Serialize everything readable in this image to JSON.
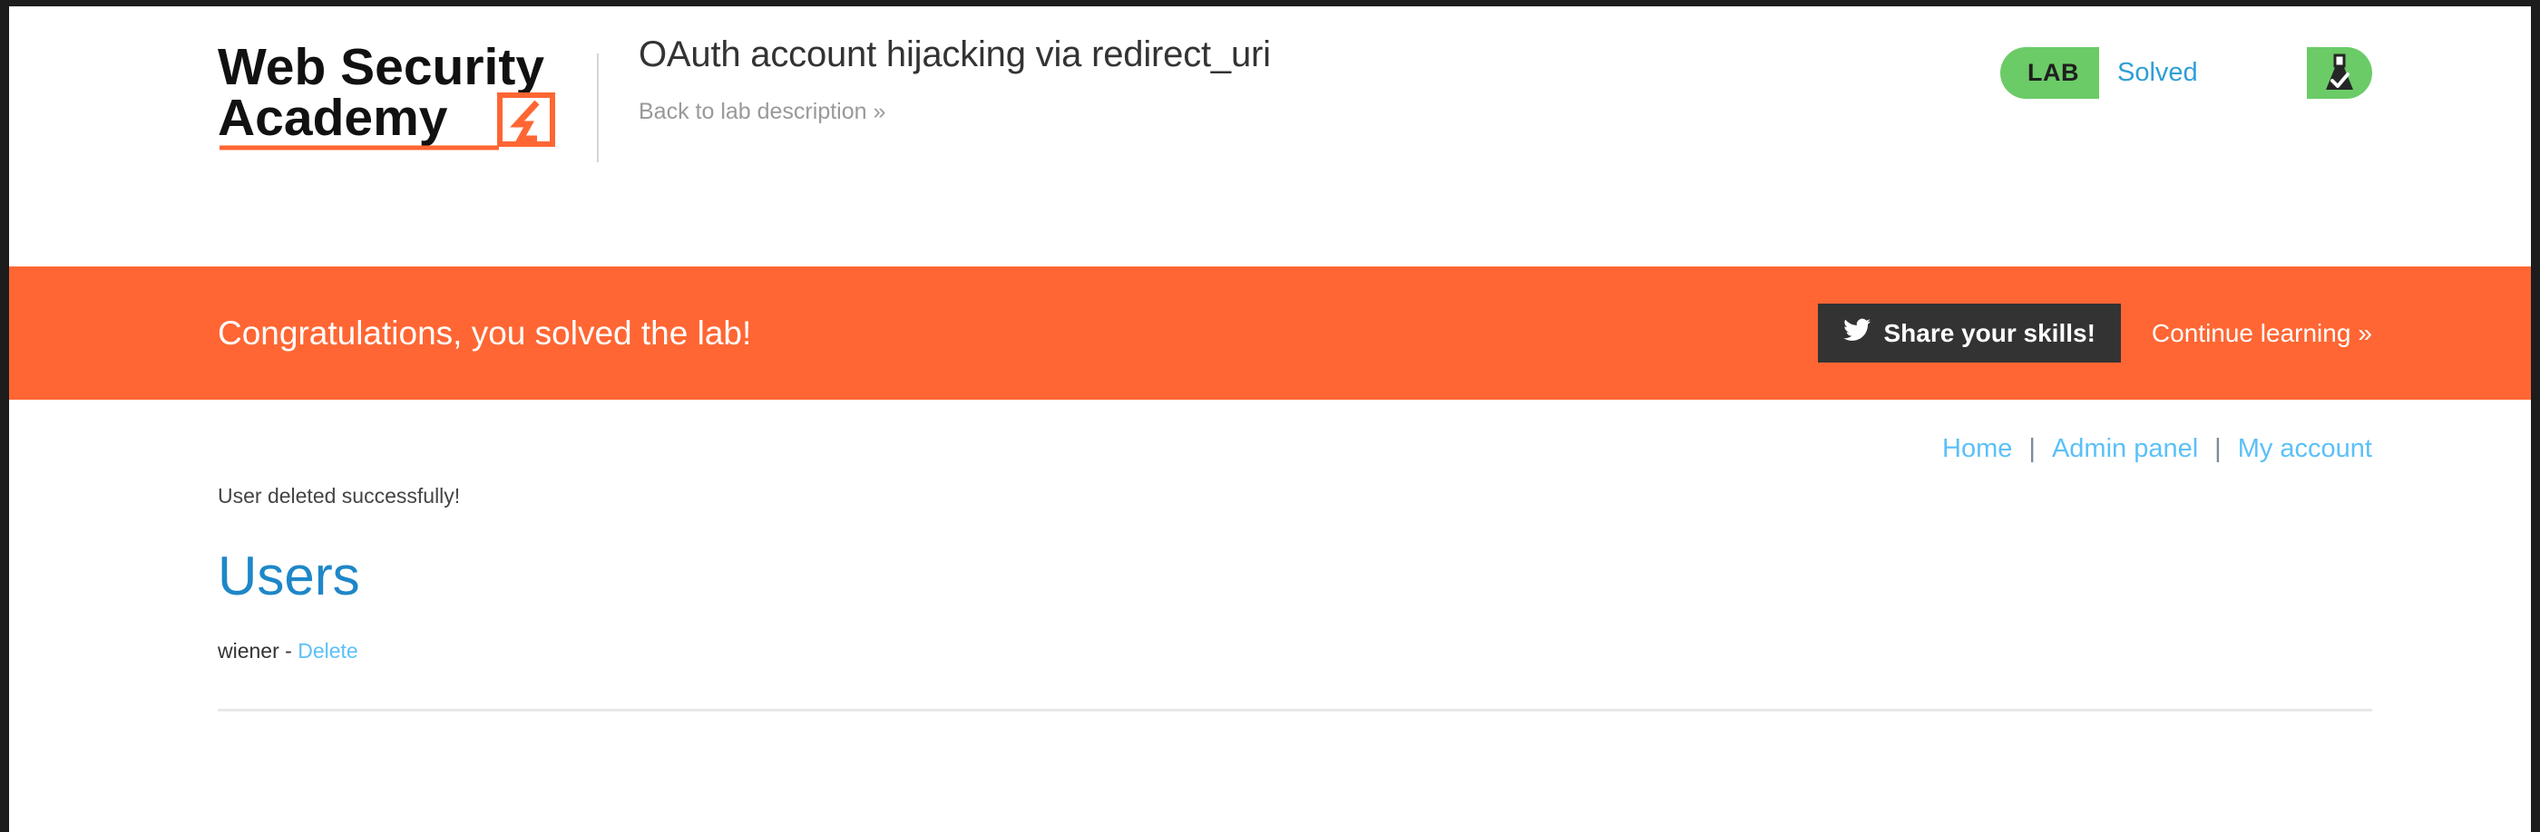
{
  "header": {
    "logo": {
      "line1": "Web Security",
      "line2": "Academy",
      "bolt_icon": "lightning-bolt-icon",
      "brand_color": "#ff6633"
    },
    "lab_title": "OAuth account hijacking via redirect_uri",
    "back_link": "Back to lab description",
    "back_chevron": "»",
    "lab_widget": {
      "tag": "LAB",
      "status": "Solved",
      "icon": "flask-check-icon",
      "bg_color": "#6bcb67",
      "status_color": "#2e9fd4"
    }
  },
  "banner": {
    "message": "Congratulations, you solved the lab!",
    "share_label": "Share your skills!",
    "share_icon": "twitter-icon",
    "continue_label": "Continue learning",
    "continue_chevron": "»",
    "bg_color": "#ff6633"
  },
  "nav": {
    "items": [
      {
        "label": "Home"
      },
      {
        "label": "Admin panel"
      },
      {
        "label": "My account"
      }
    ],
    "separator": "|",
    "link_color": "#5bc0f8"
  },
  "main": {
    "status_message": "User deleted successfully!",
    "heading": "Users",
    "users": [
      {
        "name": "wiener",
        "dash": "-",
        "action": "Delete"
      }
    ]
  }
}
